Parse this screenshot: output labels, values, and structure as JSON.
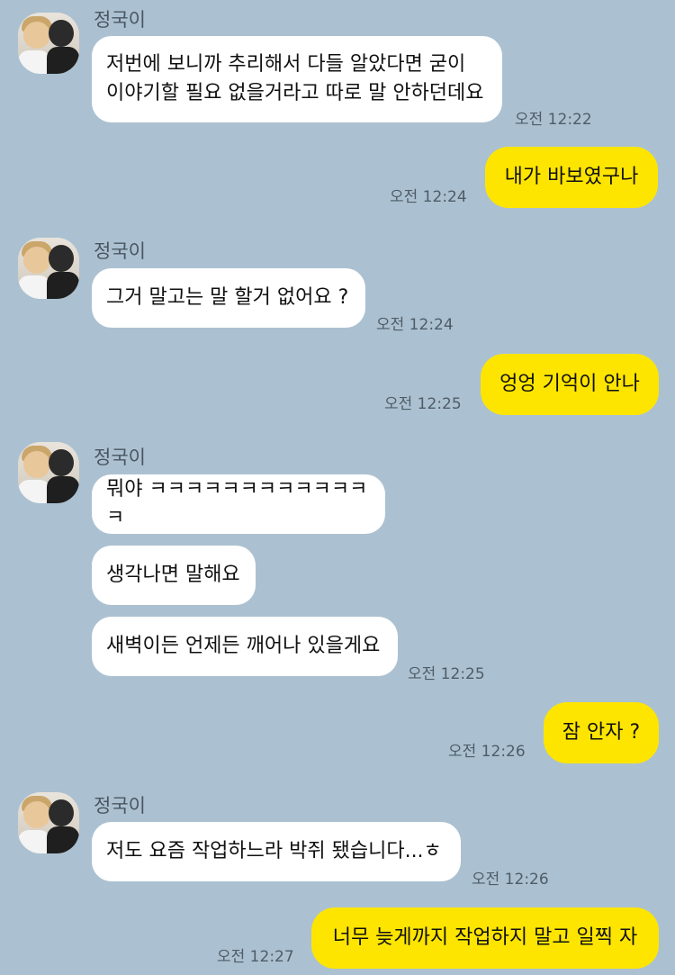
{
  "sender": "정국이",
  "messages": {
    "m1": "저번에 보니까 추리해서 다들 알았다면 굳이\n이야기할 필요 없을거라고 따로 말 안하던데요",
    "m2": "내가 바보였구나",
    "m3": "그거 말고는 말 할거 없어요 ?",
    "m4": "엉엉 기억이 안나",
    "m5": "뭐야 ㅋㅋㅋㅋㅋㅋㅋㅋㅋㅋㅋㅋㅋ",
    "m6": "생각나면 말해요",
    "m7": "새벽이든 언제든 깨어나 있을게요",
    "m8": "잠 안자 ?",
    "m9": "저도 요즘 작업하느라 박쥐 됐습니다...ㅎ",
    "m10": "너무 늦게까지 작업하지 말고 일찍 자"
  },
  "times": {
    "t1": "오전 12:22",
    "t2": "오전 12:24",
    "t3": "오전 12:24",
    "t4": "오전 12:25",
    "t5": "오전 12:25",
    "t6": "오전 12:26",
    "t7": "오전 12:26",
    "t8": "오전 12:27"
  },
  "colors": {
    "background": "#abc1d1",
    "incoming_bubble": "#ffffff",
    "outgoing_bubble": "#fee500"
  }
}
